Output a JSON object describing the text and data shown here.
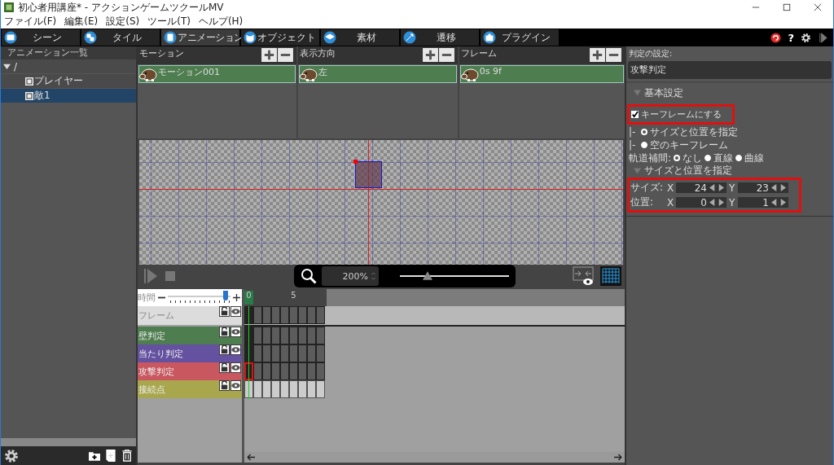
{
  "window": {
    "title": "初心者用講座* - アクションゲームツクールMV"
  },
  "menu": [
    "ファイル(F)",
    "編集(E)",
    "設定(S)",
    "ツール(T)",
    "ヘルプ(H)"
  ],
  "tabs": [
    {
      "label": "シーン",
      "selected": false,
      "kind": "scene"
    },
    {
      "label": "タイル",
      "selected": false,
      "kind": "tile"
    },
    {
      "label": "アニメーション",
      "selected": true,
      "kind": "animation"
    },
    {
      "label": "オブジェクト",
      "selected": false,
      "kind": "object"
    },
    {
      "label": "素材",
      "selected": false,
      "kind": "material"
    },
    {
      "label": "遷移",
      "selected": false,
      "kind": "transition"
    },
    {
      "label": "プラグイン",
      "selected": false,
      "kind": "plugin"
    }
  ],
  "toolbar_right": {
    "help": "?"
  },
  "sidebar": {
    "title": "アニメーション一覧",
    "tree": [
      {
        "label": "/",
        "selected": false,
        "expanded": true,
        "children": [
          {
            "label": "プレイヤー",
            "selected": false
          },
          {
            "label": "敵1",
            "selected": true
          }
        ]
      }
    ]
  },
  "lists": [
    {
      "title": "モーション",
      "items": [
        {
          "label": "モーション001",
          "selected": true
        }
      ]
    },
    {
      "title": "表示方向",
      "items": [
        {
          "label": "左",
          "selected": true
        }
      ]
    },
    {
      "title": "フレーム",
      "items": [
        {
          "label": "0s 9f",
          "selected": true
        }
      ]
    }
  ],
  "playback": {
    "zoom": "200%",
    "zoom_slider": {
      "level": 0.25
    }
  },
  "timeline": {
    "time_label": "時間",
    "time_slider": {
      "level": 0.92
    },
    "ruler": [
      {
        "label": "0",
        "selected": true
      },
      {
        "label": "5",
        "selected": false
      }
    ],
    "tracks": [
      {
        "label": "フレーム",
        "color": "#dcdcdc",
        "kind": "frame",
        "highlighted": false
      },
      {
        "label": "壁判定",
        "color": "#4e7d4f",
        "kind": "judge",
        "highlighted": false
      },
      {
        "label": "当たり判定",
        "color": "#6451a0",
        "kind": "judge",
        "highlighted": false
      },
      {
        "label": "攻撃判定",
        "color": "#c9575f",
        "kind": "judge",
        "highlighted": true
      },
      {
        "label": "接続点",
        "color": "#a9a74e",
        "kind": "point",
        "highlighted": false
      }
    ]
  },
  "properties": {
    "title": "判定の設定:",
    "name": "攻撃判定",
    "section": "基本設定",
    "keyframe": {
      "label": "キーフレームにする",
      "checked": true,
      "highlighted": true
    },
    "mode_options": [
      {
        "prefix": "|-",
        "label": "サイズと位置を指定",
        "selected": true
      },
      {
        "prefix": "|-",
        "label": "空のキーフレーム",
        "selected": false
      }
    ],
    "interpolation": {
      "label": "軌道補間:",
      "options": [
        {
          "label": "なし",
          "selected": true
        },
        {
          "label": "直線",
          "selected": false
        },
        {
          "label": "曲線",
          "selected": false
        }
      ]
    },
    "subsection": "サイズと位置を指定",
    "size_position": {
      "highlighted": true,
      "rows": [
        {
          "label": "サイズ:",
          "fields": [
            {
              "axis": "X",
              "value": "24"
            },
            {
              "axis": "Y",
              "value": "23"
            }
          ]
        },
        {
          "label": "位置:",
          "fields": [
            {
              "axis": "X",
              "value": "0"
            },
            {
              "axis": "Y",
              "value": "1"
            }
          ]
        }
      ]
    }
  }
}
